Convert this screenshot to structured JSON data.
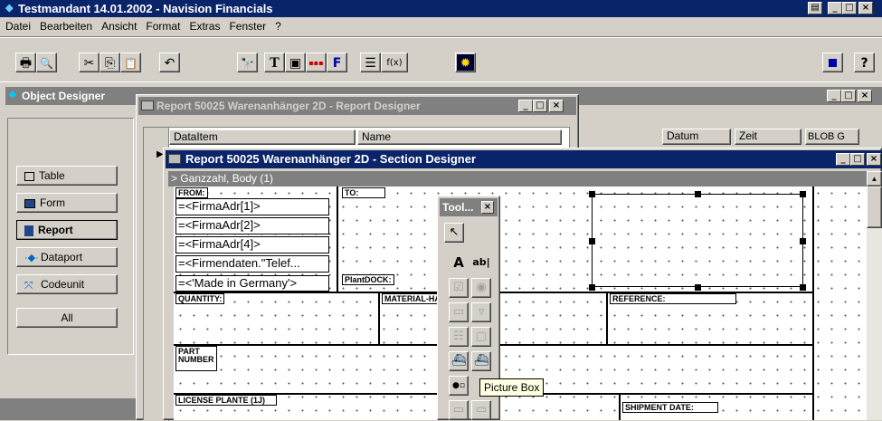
{
  "app": {
    "title": "Testmandant 14.01.2002 - Navision Financials",
    "icon": "navision-app-icon"
  },
  "menu": [
    "Datei",
    "Bearbeiten",
    "Ansicht",
    "Format",
    "Extras",
    "Fenster",
    "?"
  ],
  "toolbar": {
    "print_icon": "🖶",
    "preview_icon": "🔍",
    "cut_icon": "✂",
    "copy_icon": "⎘",
    "paste_icon": "📋",
    "undo_icon": "↶",
    "find_icon": "🔭",
    "text_icon": "T",
    "properties_icon": "▣",
    "colors_icon": "▪▪▪",
    "font_icon": "F",
    "field_menu_icon": "☰",
    "formula_icon": "f(x)",
    "sun_icon": "✹",
    "help_icon": "?"
  },
  "object_designer": {
    "title": "Object Designer",
    "buttons": [
      {
        "label": "Table",
        "icon": "table-icon"
      },
      {
        "label": "Form",
        "icon": "form-icon"
      },
      {
        "label": "Report",
        "icon": "report-icon"
      },
      {
        "label": "Dataport",
        "icon": "dataport-icon"
      },
      {
        "label": "Codeunit",
        "icon": "codeunit-icon"
      },
      {
        "label": "All",
        "icon": ""
      }
    ],
    "columns": [
      "Datum",
      "Zeit",
      "BLOB G"
    ]
  },
  "report_designer": {
    "title": "Report 50025 Warenanhänger 2D - Report Designer",
    "columns": [
      "DataItem",
      "Name"
    ]
  },
  "section_designer": {
    "title": "Report 50025 Warenanhänger 2D - Section Designer",
    "section_header": "> Ganzzahl, Body (1)",
    "labels": {
      "from": "FROM:",
      "to": "TO:",
      "plantdock": "PlantDOCK:",
      "quantity": "QUANTITY:",
      "material": "MATERIAL-HA",
      "reference": "REFERENCE:",
      "part_number_1": "PART",
      "part_number_2": "NUMBER",
      "license": "LICENSE PLANTE (1J)",
      "shipment_date": "SHIPMENT DATE:"
    },
    "fields": [
      "=<FirmaAdr[1]>",
      "=<FirmaAdr[2]>",
      "=<FirmaAdr[4]>",
      "=<Firmendaten.\"Telef...",
      "=<'Made in Germany'>"
    ]
  },
  "toolbox": {
    "title": "Tool...",
    "tooltip": "Picture Box",
    "label_tool": "A",
    "textbox_tool": "ab|"
  }
}
